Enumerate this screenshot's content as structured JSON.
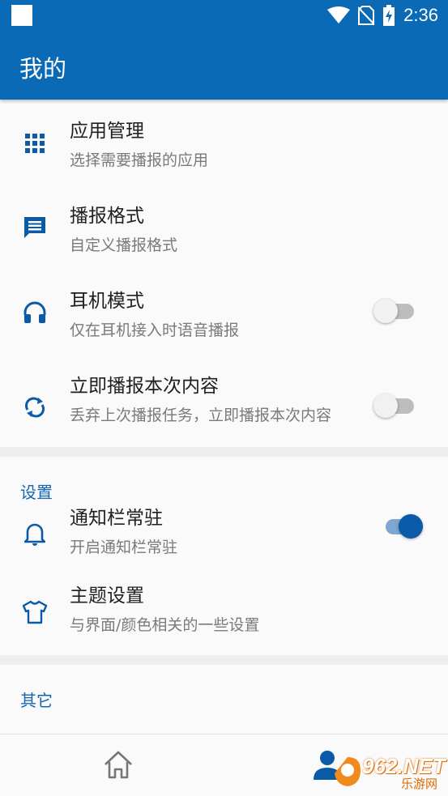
{
  "status": {
    "time": "2:36"
  },
  "appbar": {
    "title": "我的"
  },
  "items": [
    {
      "title": "应用管理",
      "summary": "选择需要播报的应用",
      "icon": "apps-grid-icon"
    },
    {
      "title": "播报格式",
      "summary": "自定义播报格式",
      "icon": "message-icon"
    },
    {
      "title": "耳机模式",
      "summary": "仅在耳机接入时语音播报",
      "icon": "headphones-icon",
      "switch_on": false
    },
    {
      "title": "立即播报本次内容",
      "summary": "丢弃上次播报任务，立即播报本次内容",
      "icon": "sync-icon",
      "switch_on": false
    }
  ],
  "settings_section": {
    "header": "设置",
    "items": [
      {
        "title": "通知栏常驻",
        "summary": "开启通知栏常驻",
        "icon": "bell-icon",
        "switch_on": true
      },
      {
        "title": "主题设置",
        "summary": "与界面/颜色相关的一些设置",
        "icon": "shirt-icon"
      }
    ]
  },
  "other_section": {
    "header": "其它"
  },
  "watermark": {
    "text": "962.NET",
    "sub": "乐游网"
  },
  "colors": {
    "primary": "#0a6ab5",
    "accent": "#0b5aa8",
    "icon": "#0b5aa8"
  }
}
